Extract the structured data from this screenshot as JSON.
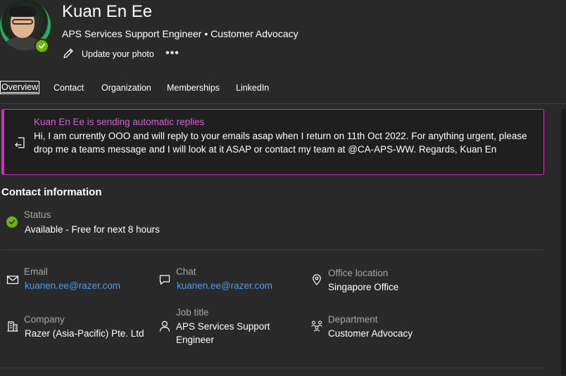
{
  "profile": {
    "name": "Kuan En Ee",
    "subtitle": "APS Services Support Engineer • Customer Advocacy",
    "update_photo_label": "Update your photo",
    "more_label": "•••",
    "presence_color": "#6bb700"
  },
  "tabs": [
    {
      "label": "Overview",
      "active": true
    },
    {
      "label": "Contact",
      "active": false
    },
    {
      "label": "Organization",
      "active": false
    },
    {
      "label": "Memberships",
      "active": false
    },
    {
      "label": "LinkedIn",
      "active": false
    }
  ],
  "auto_reply": {
    "title": "Kuan En Ee is sending automatic replies",
    "message": "Hi,  I am currently OOO and will reply to your emails asap when I return on 11th Oct 2022. For anything urgent, please drop me a teams message and I will look at it ASAP or contact  my team at @CA-APS-WW.   Regards, Kuan En",
    "accent_color": "#c239b3"
  },
  "contact": {
    "section_title": "Contact information",
    "status": {
      "label": "Status",
      "value": "Available - Free for next 8 hours"
    },
    "email": {
      "label": "Email",
      "value": "kuanen.ee@razer.com"
    },
    "chat": {
      "label": "Chat",
      "value": "kuanen.ee@razer.com"
    },
    "office": {
      "label": "Office location",
      "value": "Singapore Office"
    },
    "company": {
      "label": "Company",
      "value": "Razer (Asia-Pacific) Pte. Ltd"
    },
    "job_title": {
      "label": "Job title",
      "value": "APS Services Support Engineer"
    },
    "department": {
      "label": "Department",
      "value": "Customer Advocacy"
    }
  },
  "icons": {
    "status": "check-circle-icon",
    "email": "mail-icon",
    "chat": "chat-icon",
    "office": "location-pin-icon",
    "company": "building-icon",
    "job_title": "person-icon",
    "department": "org-chart-icon",
    "auto_reply": "exit-arrow-icon",
    "update_photo": "pencil-icon"
  },
  "colors": {
    "background": "#292929",
    "link": "#479ef5",
    "auto_reply_title": "#d65fd0"
  }
}
